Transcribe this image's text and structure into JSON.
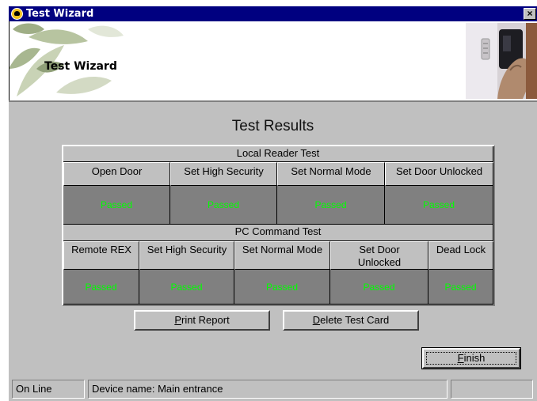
{
  "window": {
    "title": "Test Wizard",
    "close_glyph": "×",
    "title_icon": "app-icon"
  },
  "header": {
    "title": "Test Wizard",
    "left_image": "leaf-decoration",
    "right_image": "door-reader-photo"
  },
  "results": {
    "title": "Test Results",
    "local": {
      "section_title": "Local Reader Test",
      "columns": [
        "Open Door",
        "Set High Security",
        "Set Normal Mode",
        "Set Door Unlocked"
      ],
      "values": [
        "Passed",
        "Passed",
        "Passed",
        "Passed"
      ]
    },
    "pc": {
      "section_title": "PC Command Test",
      "columns": [
        "Remote REX",
        "Set High Security",
        "Set Normal Mode",
        "Set Door Unlocked",
        "Dead Lock"
      ],
      "values": [
        "Passed",
        "Passed",
        "Passed",
        "Passed",
        "Passed"
      ]
    },
    "passed_color": "#00ff00"
  },
  "buttons": {
    "print_report": {
      "accel": "P",
      "rest": "rint Report"
    },
    "delete_test_card": {
      "accel": "D",
      "rest": "elete Test Card"
    },
    "finish": {
      "accel": "F",
      "rest": "inish"
    }
  },
  "status": {
    "connection": "On Line",
    "device": "Device name: Main entrance",
    "extra": ""
  }
}
